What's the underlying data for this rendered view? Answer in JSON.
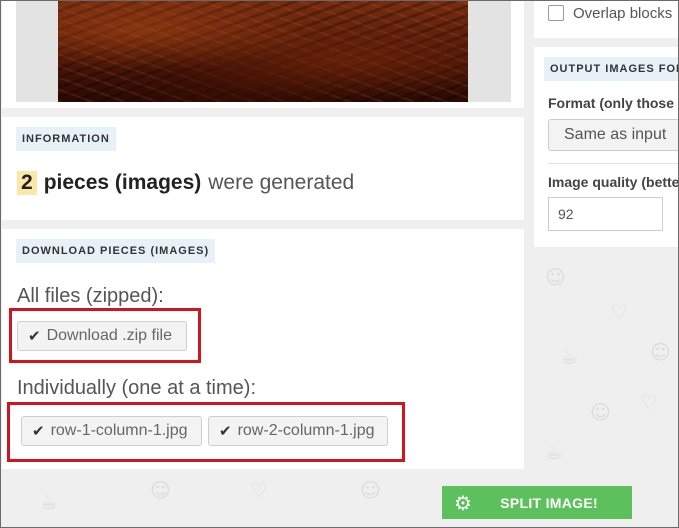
{
  "information": {
    "section_label": "INFORMATION",
    "count": "2",
    "pieces_text": "pieces (images)",
    "suffix_text": "were generated"
  },
  "download": {
    "section_label": "DOWNLOAD PIECES (IMAGES)",
    "all_files_heading": "All files (zipped):",
    "zip_button": "Download .zip file",
    "individually_heading": "Individually (one at a time):",
    "files": [
      "row-1-column-1.jpg",
      "row-2-column-1.jpg"
    ]
  },
  "options": {
    "overlap_label": "Overlap blocks",
    "output_section_label": "OUTPUT IMAGES FOR",
    "format_label": "Format (only those s",
    "format_value": "Same as input",
    "quality_label": "Image quality (bette",
    "quality_value": "92"
  },
  "split_button": "SPLIT IMAGE!",
  "icons": {
    "check": "check-icon",
    "gear": "gear-icon"
  },
  "colors": {
    "accent_green": "#5cc15c",
    "highlight_red": "#d0161c",
    "label_bg": "#e8f1f8",
    "badge_bg": "#fbe7a6"
  }
}
